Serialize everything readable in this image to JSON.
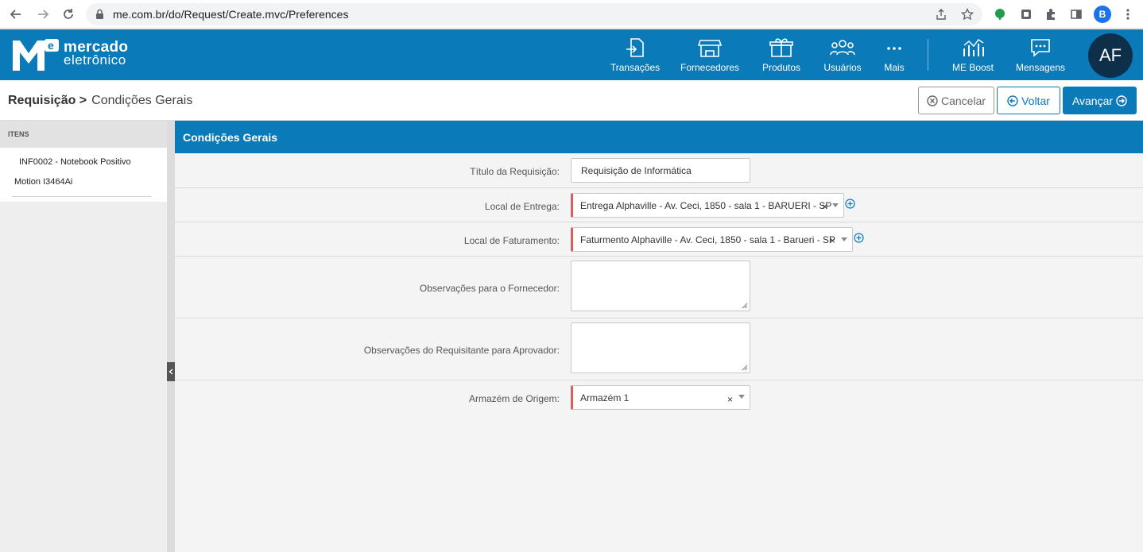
{
  "browser": {
    "url": "me.com.br/do/Request/Create.mvc/Preferences",
    "profile_initial": "B"
  },
  "header": {
    "logo_line1": "mercado",
    "logo_line2": "eletrônico",
    "nav": [
      {
        "label": "Transações",
        "icon": "transactions-icon"
      },
      {
        "label": "Fornecedores",
        "icon": "store-icon"
      },
      {
        "label": "Produtos",
        "icon": "box-icon"
      },
      {
        "label": "Usuários",
        "icon": "users-icon"
      },
      {
        "label": "Mais",
        "icon": "more-icon"
      },
      {
        "label": "ME Boost",
        "icon": "chart-icon"
      },
      {
        "label": "Mensagens",
        "icon": "message-icon"
      }
    ],
    "avatar_initials": "AF",
    "accent_color": "#0b7ab8"
  },
  "subheader": {
    "breadcrumb_root": "Requisição >",
    "breadcrumb_current": "Condições Gerais",
    "cancel_label": "Cancelar",
    "back_label": "Voltar",
    "next_label": "Avançar"
  },
  "sidebar": {
    "heading": "ITENS",
    "items": [
      {
        "line1": "INF0002 - Notebook Positivo",
        "line2": "Motion I3464Ai"
      }
    ]
  },
  "form": {
    "title": "Condições Gerais",
    "titulo_label": "Título da Requisição:",
    "titulo_value": "Requisição de Informática",
    "entrega_label": "Local de Entrega:",
    "entrega_value": "Entrega Alphaville - Av. Ceci, 1850 - sala 1 - BARUERI - SP",
    "faturamento_label": "Local de Faturamento:",
    "faturamento_value": "Faturmento Alphaville - Av. Ceci, 1850 - sala 1 - Barueri - SP",
    "obs_fornecedor_label": "Observações para o Fornecedor:",
    "obs_aprovador_label": "Observações do Requisitante para Aprovador:",
    "armazem_label": "Armazém de Origem:",
    "armazem_value": "Armazém 1",
    "clear_symbol": "×"
  }
}
